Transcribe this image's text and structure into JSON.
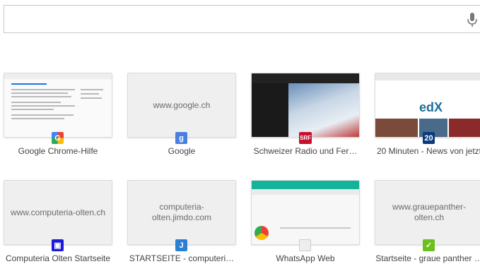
{
  "search": {
    "placeholder": "",
    "mic_icon": "microphone-icon"
  },
  "tiles": [
    {
      "title": "Google Chrome-Hilfe",
      "thumb_text": "",
      "favicon": "G",
      "favicon_color": "#4285f4"
    },
    {
      "title": "Google",
      "thumb_text": "www.google.ch",
      "favicon": "g",
      "favicon_color": "#4a7fe0"
    },
    {
      "title": "Schweizer Radio und Fer…",
      "thumb_text": "",
      "favicon": "SRF",
      "favicon_color": "#c8102e"
    },
    {
      "title": "20 Minuten - News von jetzt",
      "thumb_text": "",
      "favicon": "20",
      "favicon_color": "#0b3b7a"
    },
    {
      "title": "Computeria Olten Startseite",
      "thumb_text": "www.computeria-olten.ch",
      "favicon": "▣",
      "favicon_color": "#1a1ad8"
    },
    {
      "title": "STARTSEITE - computeri…",
      "thumb_text": "computeria-olten.jimdo.com",
      "favicon": "J",
      "favicon_color": "#2d7fd3"
    },
    {
      "title": "WhatsApp Web",
      "thumb_text": "",
      "favicon": "",
      "favicon_color": "#eeeeee"
    },
    {
      "title": "Startseite - graue panther …",
      "thumb_text": "www.grauepanther-olten.ch",
      "favicon": "✓",
      "favicon_color": "#6bbf1f"
    }
  ]
}
